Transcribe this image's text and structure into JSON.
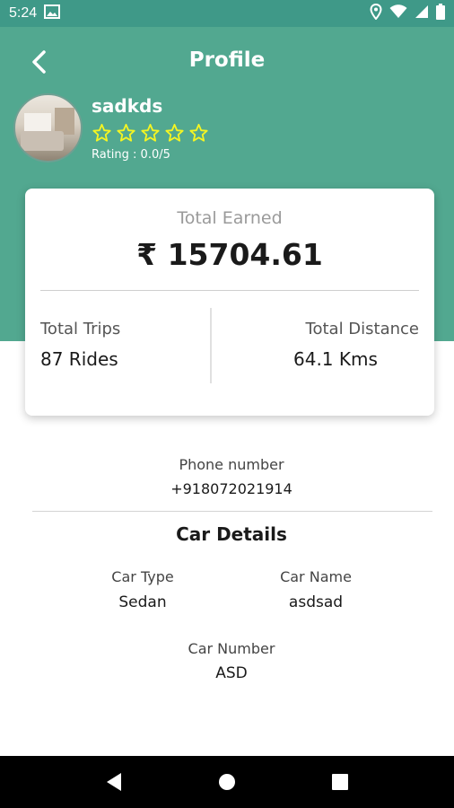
{
  "status_bar": {
    "time": "5:24",
    "icons": [
      "image-icon",
      "location-icon",
      "wifi-icon",
      "signal-icon",
      "battery-icon"
    ]
  },
  "header": {
    "title": "Profile",
    "back_icon": "chevron-left-icon",
    "background_color": "#52a890"
  },
  "profile": {
    "name": "sadkds",
    "stars_total": 5,
    "stars_filled": 0,
    "star_color": "#f5f522",
    "rating_text": "Rating : 0.0/5"
  },
  "earnings": {
    "total_earned_label": "Total Earned",
    "total_earned_value": "₹ 15704.61",
    "total_trips_label": "Total Trips",
    "total_trips_value": "87 Rides",
    "total_distance_label": "Total Distance",
    "total_distance_value": "64.1 Kms"
  },
  "contact": {
    "phone_label": "Phone number",
    "phone_value": "+918072021914"
  },
  "car": {
    "section_title": "Car Details",
    "type_label": "Car Type",
    "type_value": "Sedan",
    "name_label": "Car Name",
    "name_value": "asdsad",
    "number_label": "Car Number",
    "number_value": "ASD"
  },
  "nav": {
    "buttons": [
      "back-triangle-icon",
      "home-circle-icon",
      "recents-square-icon"
    ]
  }
}
